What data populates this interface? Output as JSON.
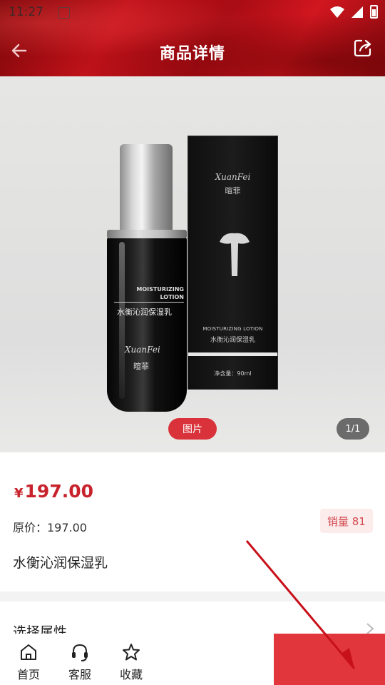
{
  "status": {
    "time": "11:27"
  },
  "header": {
    "title": "商品详情",
    "back_icon": "arrow-left-icon",
    "share_icon": "share-icon"
  },
  "gallery": {
    "picture_label": "图片",
    "counter": "1/1",
    "bottle": {
      "lotion_line1": "MOISTURIZING",
      "lotion_line2": "LOTION",
      "cn_name": "水衡沁润保湿乳",
      "brand_en": "XuanFei",
      "brand_cn": "暄菲"
    },
    "box": {
      "brand_en": "XuanFei",
      "brand_cn": "暄菲",
      "lotion": "MOISTURIZING LOTION",
      "cn_name": "水衡沁润保湿乳",
      "net": "净含量：90ml"
    }
  },
  "product": {
    "currency": "¥",
    "price": "197.00",
    "original_price": "原价：197.00",
    "sales": "销量 81",
    "name": "水衡沁润保湿乳"
  },
  "attributes": {
    "label": "选择属性"
  },
  "bottom_nav": [
    {
      "label": "首页",
      "icon": "home-icon"
    },
    {
      "label": "客服",
      "icon": "headset-icon"
    },
    {
      "label": "收藏",
      "icon": "star-icon"
    }
  ],
  "colors": {
    "brand_red": "#c8232c",
    "buy_button": "#e0363c"
  }
}
